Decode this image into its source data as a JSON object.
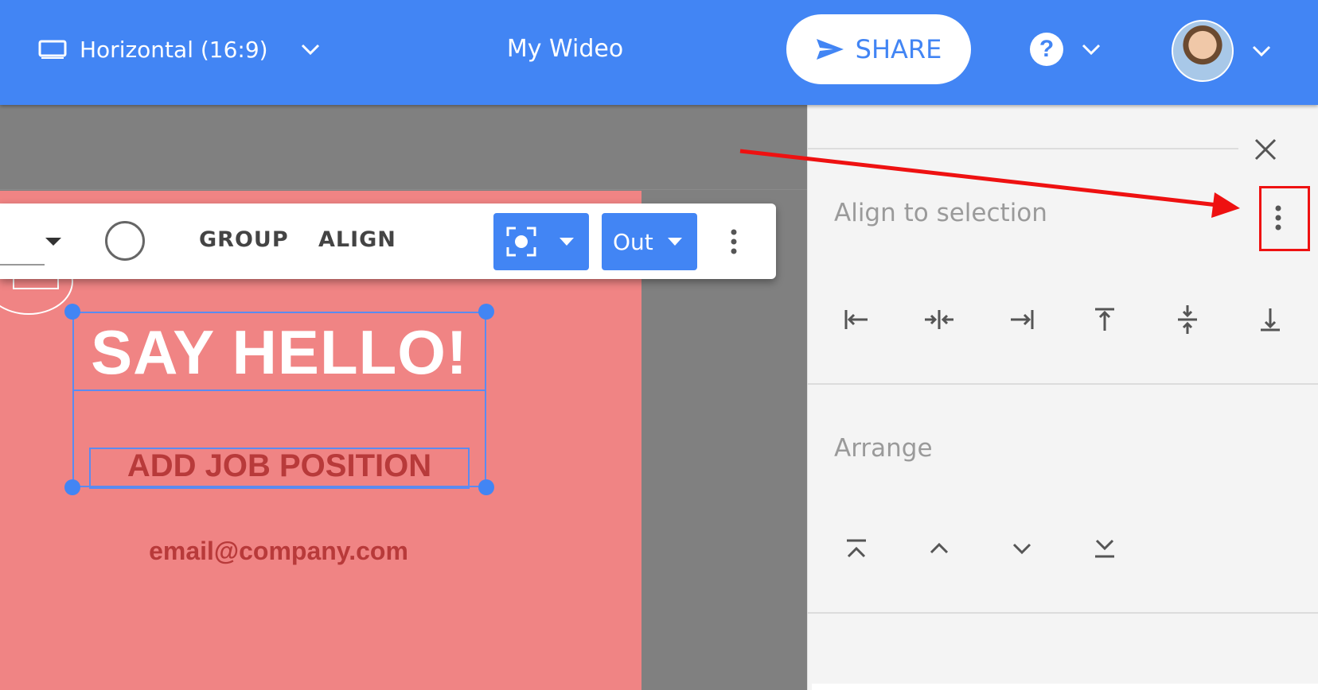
{
  "header": {
    "format_label": "Horizontal (16:9)",
    "title": "My Wideo",
    "share_label": "SHARE",
    "help_label": "?"
  },
  "canvas": {
    "headline": "SAY HELLO!",
    "subtitle": "ADD JOB POSITION",
    "email": "email@company.com"
  },
  "toolbar": {
    "group_label": "GROUP",
    "align_label": "ALIGN",
    "transition_out_label": "Out"
  },
  "panel": {
    "align_title": "Align to selection",
    "arrange_title": "Arrange",
    "align_icons": [
      "align-left-icon",
      "align-center-horizontal-icon",
      "align-right-icon",
      "align-top-icon",
      "align-middle-vertical-icon",
      "align-bottom-icon"
    ],
    "arrange_icons": [
      "bring-to-front-icon",
      "bring-forward-icon",
      "send-backward-icon",
      "send-to-back-icon"
    ]
  },
  "colors": {
    "header_blue": "#4285f4",
    "slide_pink": "#f08484",
    "text_dark_red": "#b83a3a",
    "annotation_red": "#ee1111"
  }
}
